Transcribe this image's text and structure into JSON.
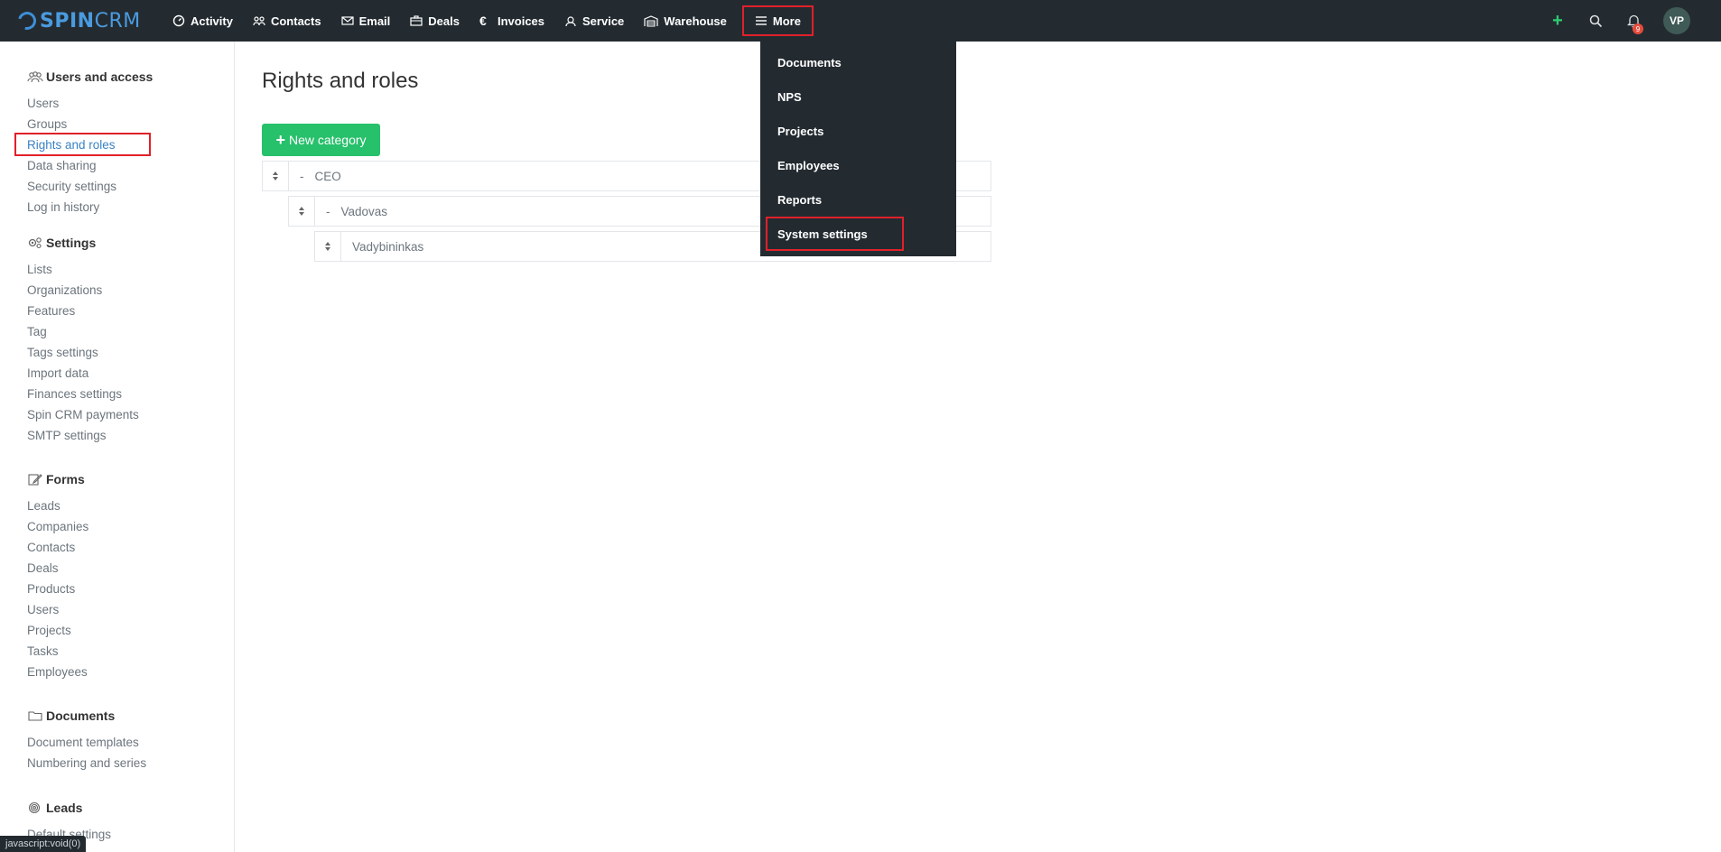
{
  "brand": {
    "name_a": "SPIN",
    "name_b": "CRM",
    "color": "#4a9be0"
  },
  "nav": {
    "items": [
      {
        "label": "Activity",
        "icon": "gauge-icon"
      },
      {
        "label": "Contacts",
        "icon": "people-icon"
      },
      {
        "label": "Email",
        "icon": "envelope-icon"
      },
      {
        "label": "Deals",
        "icon": "briefcase-icon"
      },
      {
        "label": "Invoices",
        "icon": "euro-icon"
      },
      {
        "label": "Service",
        "icon": "headset-icon"
      },
      {
        "label": "Warehouse",
        "icon": "warehouse-icon"
      }
    ],
    "more_label": "More",
    "notifications_count": "9",
    "avatar_initials": "VP"
  },
  "dropdown": {
    "items": [
      "Documents",
      "NPS",
      "Projects",
      "Employees",
      "Reports",
      "System settings"
    ]
  },
  "sidebar": {
    "sections": [
      {
        "title": "Users and access",
        "icon": "people-icon",
        "links": [
          "Users",
          "Groups",
          "Rights and roles",
          "Data sharing",
          "Security settings",
          "Log in history"
        ]
      },
      {
        "title": "Settings",
        "icon": "gears-icon",
        "links": [
          "Lists",
          "Organizations",
          "Features",
          "Tag",
          "Tags settings",
          "Import data",
          "Finances settings",
          "Spin CRM payments",
          "SMTP settings"
        ]
      },
      {
        "title": "Forms",
        "icon": "edit-icon",
        "links": [
          "Leads",
          "Companies",
          "Contacts",
          "Deals",
          "Products",
          "Users",
          "Projects",
          "Tasks",
          "Employees"
        ]
      },
      {
        "title": "Documents",
        "icon": "folder-icon",
        "links": [
          "Document templates",
          "Numbering and series"
        ]
      },
      {
        "title": "Leads",
        "icon": "target-icon",
        "links": [
          "Default settings"
        ]
      }
    ]
  },
  "main": {
    "title": "Rights and roles",
    "new_category_label": "New category",
    "roles": [
      {
        "prefix": "-",
        "name": "CEO",
        "level": 0
      },
      {
        "prefix": "-",
        "name": "Vadovas",
        "level": 1
      },
      {
        "prefix": "",
        "name": "Vadybininkas",
        "level": 2
      }
    ]
  },
  "status_bar": "javascript:void(0)",
  "colors": {
    "topbar": "#232b31",
    "accent_green": "#27c06b",
    "highlight_red": "#e0202a",
    "link_active": "#3b82c4"
  }
}
